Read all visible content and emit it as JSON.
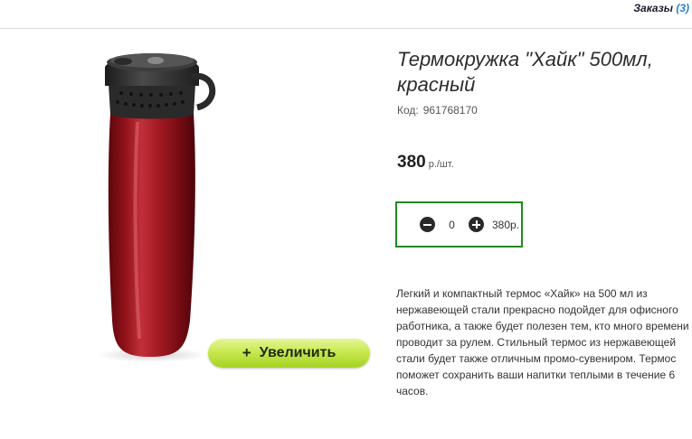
{
  "header": {
    "orders_label": "Заказы",
    "orders_count": "(3)"
  },
  "product": {
    "title": "Термокружка \"Хайк\" 500мл, красный",
    "sku_label": "Код:",
    "sku": "961768170",
    "price": "380",
    "price_unit": "р./шт.",
    "zoom_button": {
      "plus": "+",
      "label": "Увеличить"
    },
    "quantity": {
      "value": "0",
      "total": "380р.",
      "minus_icon": "minus-circle-icon",
      "plus_icon": "plus-circle-icon"
    },
    "description": "Легкий и компактный термос «Хайк» на 500 мл из нержавеющей стали прекрасно подойдет для офисного работника, а также будет полезен тем, кто много времени проводит за рулем. Стильный термос из нержавеющей стали будет также отличным промо-сувениром. Термос поможет сохранить ваши напитки теплыми в течение 6 часов."
  },
  "colors": {
    "orders_count": "#2f7fd1",
    "qty_border": "#1f8a1f",
    "button_top": "#e6f79a",
    "button_bottom": "#a6d223",
    "mug_body": "#9b141c",
    "mug_lid": "#2b2b2b"
  }
}
